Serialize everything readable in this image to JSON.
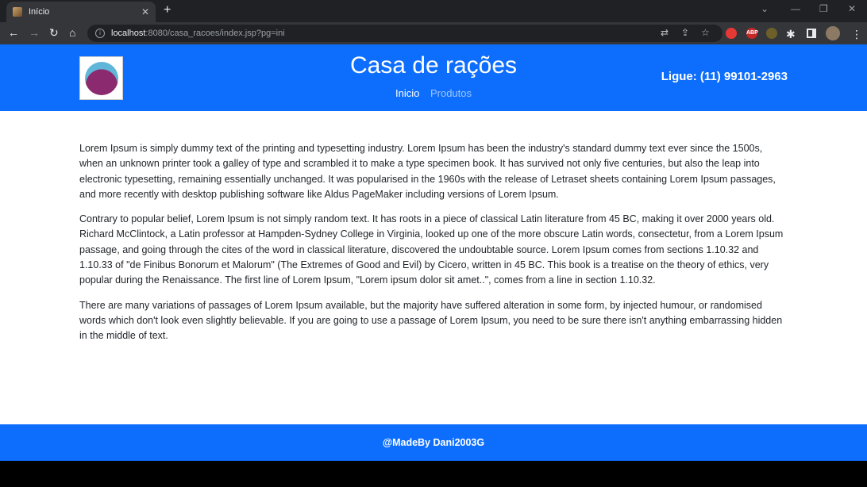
{
  "browser": {
    "tab_title": "Início",
    "close_glyph": "✕",
    "new_tab_glyph": "+",
    "url_host": "localhost",
    "url_rest": ":8080/casa_racoes/index.jsp?pg=ini",
    "extensions": [
      {
        "icon": "red-extension-icon",
        "color": "#e53935",
        "label": ""
      },
      {
        "icon": "abp-icon",
        "color": "#c62828",
        "label": "ABP"
      },
      {
        "icon": "shield-extension-icon",
        "color": "#6d5f2a",
        "label": ""
      }
    ]
  },
  "header": {
    "title": "Casa de rações",
    "nav": [
      {
        "label": "Inicio",
        "active": true
      },
      {
        "label": "Produtos",
        "active": false
      }
    ],
    "phone": "Ligue: (11) 99101-2963",
    "bg_color": "#0d6efd"
  },
  "content": {
    "paragraphs": [
      "Lorem Ipsum is simply dummy text of the printing and typesetting industry. Lorem Ipsum has been the industry's standard dummy text ever since the 1500s, when an unknown printer took a galley of type and scrambled it to make a type specimen book. It has survived not only five centuries, but also the leap into electronic typesetting, remaining essentially unchanged. It was popularised in the 1960s with the release of Letraset sheets containing Lorem Ipsum passages, and more recently with desktop publishing software like Aldus PageMaker including versions of Lorem Ipsum.",
      "Contrary to popular belief, Lorem Ipsum is not simply random text. It has roots in a piece of classical Latin literature from 45 BC, making it over 2000 years old. Richard McClintock, a Latin professor at Hampden-Sydney College in Virginia, looked up one of the more obscure Latin words, consectetur, from a Lorem Ipsum passage, and going through the cites of the word in classical literature, discovered the undoubtable source. Lorem Ipsum comes from sections 1.10.32 and 1.10.33 of \"de Finibus Bonorum et Malorum\" (The Extremes of Good and Evil) by Cicero, written in 45 BC. This book is a treatise on the theory of ethics, very popular during the Renaissance. The first line of Lorem Ipsum, \"Lorem ipsum dolor sit amet..\", comes from a line in section 1.10.32.",
      "There are many variations of passages of Lorem Ipsum available, but the majority have suffered alteration in some form, by injected humour, or randomised words which don't look even slightly believable. If you are going to use a passage of Lorem Ipsum, you need to be sure there isn't anything embarrassing hidden in the middle of text."
    ]
  },
  "footer": {
    "text": "@MadeBy Dani2003G"
  }
}
